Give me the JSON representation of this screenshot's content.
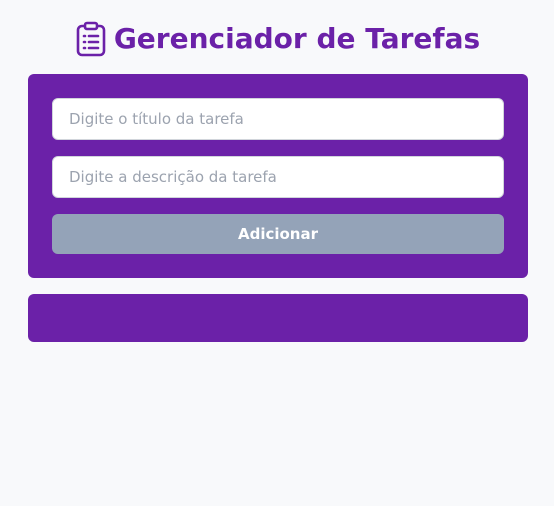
{
  "header": {
    "title": "Gerenciador de Tarefas",
    "icon": "clipboard-list-icon"
  },
  "form": {
    "title_placeholder": "Digite o título da tarefa",
    "title_value": "",
    "description_placeholder": "Digite a descrição da tarefa",
    "description_value": "",
    "add_label": "Adicionar"
  },
  "task_list": {
    "items": []
  },
  "colors": {
    "primary": "#6b21a8",
    "button_disabled": "#94a3b8",
    "background": "#f8f9fb",
    "input_background": "#ffffff"
  }
}
